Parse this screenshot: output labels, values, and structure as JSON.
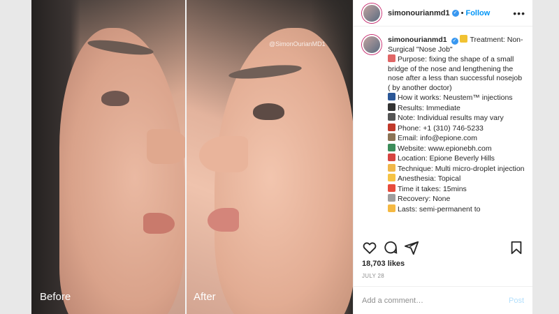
{
  "media": {
    "before_label": "Before",
    "after_label": "After",
    "watermark": "@SimonOurianMD1"
  },
  "header": {
    "username": "simonourianmd1",
    "verified_icon": "✓",
    "separator": "•",
    "follow_label": "Follow",
    "more_label": "•••"
  },
  "caption": {
    "username": "simonourianmd1",
    "lines": [
      {
        "emoji_color": "#f1c232",
        "text": "Treatment: Non-Surgical \"Nose Job\"",
        "inline": true
      },
      {
        "emoji_color": "#e06666",
        "text": "Purpose: fixing the shape of a small bridge of the nose and lengthening the nose after a less than successful nosejob ( by another doctor)"
      },
      {
        "emoji_color": "#2b5797",
        "text": "How it works: Neustem™ injections"
      },
      {
        "emoji_color": "#333333",
        "text": "Results: Immediate"
      },
      {
        "emoji_color": "#555555",
        "text": "Note: Individual results may vary"
      },
      {
        "emoji_color": "#c0392b",
        "text": "Phone: +1 (310) 746-5233"
      },
      {
        "emoji_color": "#8b7355",
        "text": "Email: info@epione.com"
      },
      {
        "emoji_color": "#3c8d5a",
        "text": "Website: www.epionebh.com"
      },
      {
        "emoji_color": "#d64541",
        "text": "Location: Epione Beverly Hills"
      },
      {
        "emoji_color": "#f0b74a",
        "text": "Technique: Multi micro-droplet injection"
      },
      {
        "emoji_color": "#f6c344",
        "text": "Anesthesia: Topical"
      },
      {
        "emoji_color": "#e74c3c",
        "text": "Time it takes: 15mins"
      },
      {
        "emoji_color": "#9e9e9e",
        "text": "Recovery: None"
      },
      {
        "emoji_color": "#f5b942",
        "text": "Lasts: semi-permanent to"
      }
    ]
  },
  "actions": {
    "like_icon": "heart-icon",
    "comment_icon": "comment-icon",
    "share_icon": "share-icon",
    "save_icon": "bookmark-icon"
  },
  "likes": "18,703 likes",
  "date": "JULY 28",
  "comment": {
    "placeholder": "Add a comment…",
    "post_label": "Post"
  },
  "colors": {
    "accent": "#0095f6",
    "post_disabled": "#b2dffc",
    "verified": "#3897f0"
  }
}
